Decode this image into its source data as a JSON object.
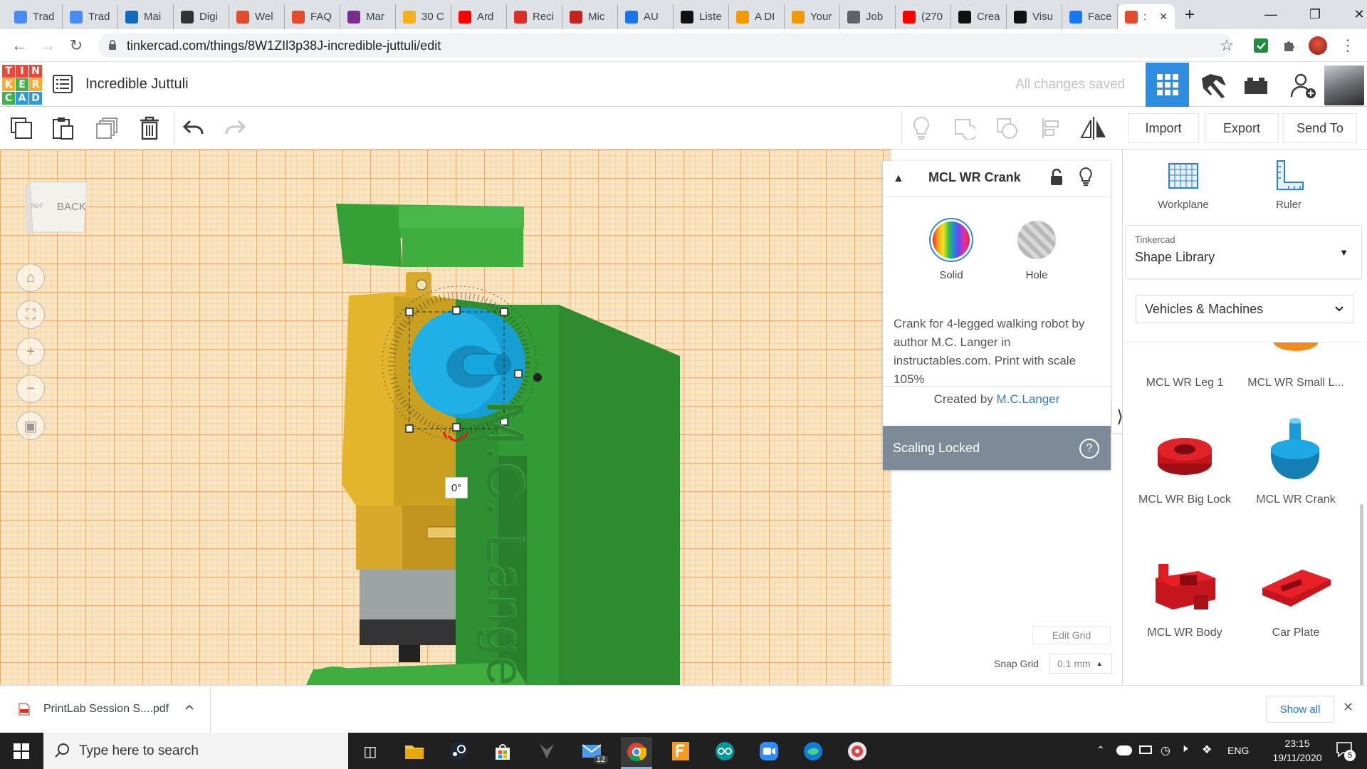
{
  "browser": {
    "tabs": [
      {
        "label": "Trad",
        "color": "#4a8af4"
      },
      {
        "label": "Trad",
        "color": "#4a8af4"
      },
      {
        "label": "Mai",
        "color": "#0f6cbd"
      },
      {
        "label": "Digi",
        "color": "#333333"
      },
      {
        "label": "Wel",
        "color": "#e34a2e"
      },
      {
        "label": "FAQ",
        "color": "#e34a2e"
      },
      {
        "label": "Mar",
        "color": "#7b2d8e"
      },
      {
        "label": "30 C",
        "color": "#f2b21b"
      },
      {
        "label": "Ard",
        "color": "#ff0000"
      },
      {
        "label": "Reci",
        "color": "#d93025"
      },
      {
        "label": "Mic",
        "color": "#c5221f"
      },
      {
        "label": "AU",
        "color": "#1a73e8"
      },
      {
        "label": "Liste",
        "color": "#111111"
      },
      {
        "label": "A DI",
        "color": "#f29900"
      },
      {
        "label": "Your",
        "color": "#f29900"
      },
      {
        "label": "Job",
        "color": "#5f6368"
      },
      {
        "label": "(270",
        "color": "#ff0000"
      },
      {
        "label": "Crea",
        "color": "#111111"
      },
      {
        "label": "Visu",
        "color": "#111111"
      },
      {
        "label": "Face",
        "color": "#1877f2"
      },
      {
        "label": ":",
        "color": "#e34a2e"
      }
    ],
    "url": "tinkercad.com/things/8W1ZIl3p38J-incredible-juttuli/edit",
    "minimize": "—",
    "maximize": "❐",
    "close": "✕",
    "new_tab": "+"
  },
  "app": {
    "logo_letters": [
      "T",
      "I",
      "N",
      "K",
      "E",
      "R",
      "C",
      "A",
      "D"
    ],
    "logo_colors": [
      "#e8493a",
      "#e8493a",
      "#e8493a",
      "#fcab2b",
      "#42b34b",
      "#fcab2b",
      "#42b34b",
      "#2d9ae4",
      "#2d9ae4"
    ],
    "design_title": "Incredible Juttuli",
    "save_status": "All changes saved"
  },
  "toolbar": {
    "import": "Import",
    "export": "Export",
    "send_to": "Send To"
  },
  "viewcube": {
    "left": "RIGHT",
    "front": "BACK"
  },
  "workplane": {
    "rotation_label": "0°",
    "engraved_text": "M.C. Langer",
    "edit_grid": "Edit Grid",
    "snap_grid_label": "Snap Grid",
    "snap_grid_value": "0.1 mm"
  },
  "inspector": {
    "name": "MCL WR Crank",
    "solid": "Solid",
    "hole": "Hole",
    "description": "Crank for 4-legged walking robot by author M.C. Langer in instructables.com. Print with scale 105%",
    "created_by": "Created by",
    "author": "M.C.Langer",
    "scaling_locked": "Scaling Locked",
    "help": "?"
  },
  "right_panel": {
    "workplane": "Workplane",
    "ruler": "Ruler",
    "library_group": "Tinkercad",
    "library_name": "Shape Library",
    "category": "Vehicles & Machines",
    "shapes": [
      {
        "label": "MCL WR Leg 1",
        "color": "#f28b1c"
      },
      {
        "label": "MCL WR Small L...",
        "color": "#f28b1c"
      },
      {
        "label": "MCL WR Big Lock",
        "color": "#c4161c"
      },
      {
        "label": "MCL WR Crank",
        "color": "#1a9ad6"
      },
      {
        "label": "MCL WR Body",
        "color": "#e11b22"
      },
      {
        "label": "Car Plate",
        "color": "#e11b22"
      }
    ]
  },
  "downloads": {
    "file": "PrintLab Session S....pdf",
    "show_all": "Show all"
  },
  "taskbar": {
    "search_placeholder": "Type here to search",
    "mail_badge": "12",
    "language": "ENG",
    "time": "23:15",
    "date": "19/11/2020",
    "notifications": "5"
  }
}
